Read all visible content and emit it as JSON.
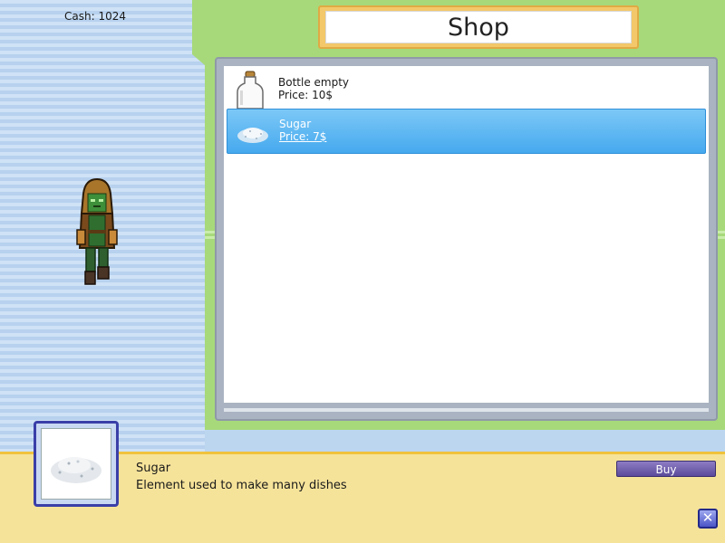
{
  "hud": {
    "cash_label": "Cash: 1024"
  },
  "shop": {
    "title": "Shop",
    "items": [
      {
        "name": "Bottle empty",
        "price": "Price: 10$",
        "icon": "bottle-icon",
        "selected": false
      },
      {
        "name": "Sugar",
        "price": "Price: 7$",
        "icon": "sugar-icon",
        "selected": true
      }
    ]
  },
  "details": {
    "name": "Sugar",
    "description": "Element used to make many dishes",
    "icon": "sugar-icon"
  },
  "actions": {
    "buy_label": "Buy",
    "close_icon": "close-icon"
  },
  "colors": {
    "panel_green": "#a7d97a",
    "selection_blue": "#46a9ee",
    "info_bar": "#f6e39a",
    "buy_button": "#5b4a9a"
  }
}
